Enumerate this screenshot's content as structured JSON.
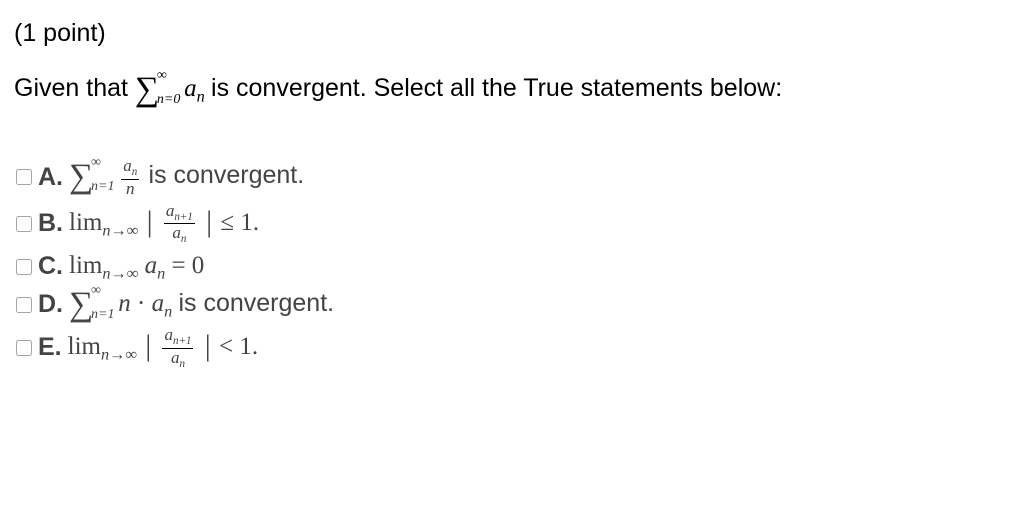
{
  "points_label": "(1 point)",
  "prompt_prefix": "Given that ",
  "prompt_sum_upper": "∞",
  "prompt_sum_lower": "n=0",
  "prompt_sum_term": "aₙ",
  "prompt_suffix": " is convergent. Select all the True statements below:",
  "options": [
    {
      "letter": "A.",
      "text_after": " is convergent."
    },
    {
      "letter": "B.",
      "text_after": ""
    },
    {
      "letter": "C.",
      "text_after": ""
    },
    {
      "letter": "D.",
      "text_after": " is convergent."
    },
    {
      "letter": "E.",
      "text_after": ""
    }
  ],
  "math": {
    "A": {
      "sum_upper": "∞",
      "sum_lower": "n=1",
      "frac_num": "aₙ",
      "frac_den": "n"
    },
    "B": {
      "lim": "lim",
      "subscript": "n→∞",
      "frac_num": "aₙ₊₁",
      "frac_den": "aₙ",
      "rel": "≤",
      "rhs": "1."
    },
    "C": {
      "lim": "lim",
      "subscript": "n→∞",
      "term": "aₙ",
      "eq": "=",
      "rhs": "0"
    },
    "D": {
      "sum_upper": "∞",
      "sum_lower": "n=1",
      "coeff": "n",
      "dot": "·",
      "term": "aₙ"
    },
    "E": {
      "lim": "lim",
      "subscript": "n→∞",
      "frac_num": "aₙ₊₁",
      "frac_den": "aₙ",
      "rel": "<",
      "rhs": "1."
    }
  }
}
